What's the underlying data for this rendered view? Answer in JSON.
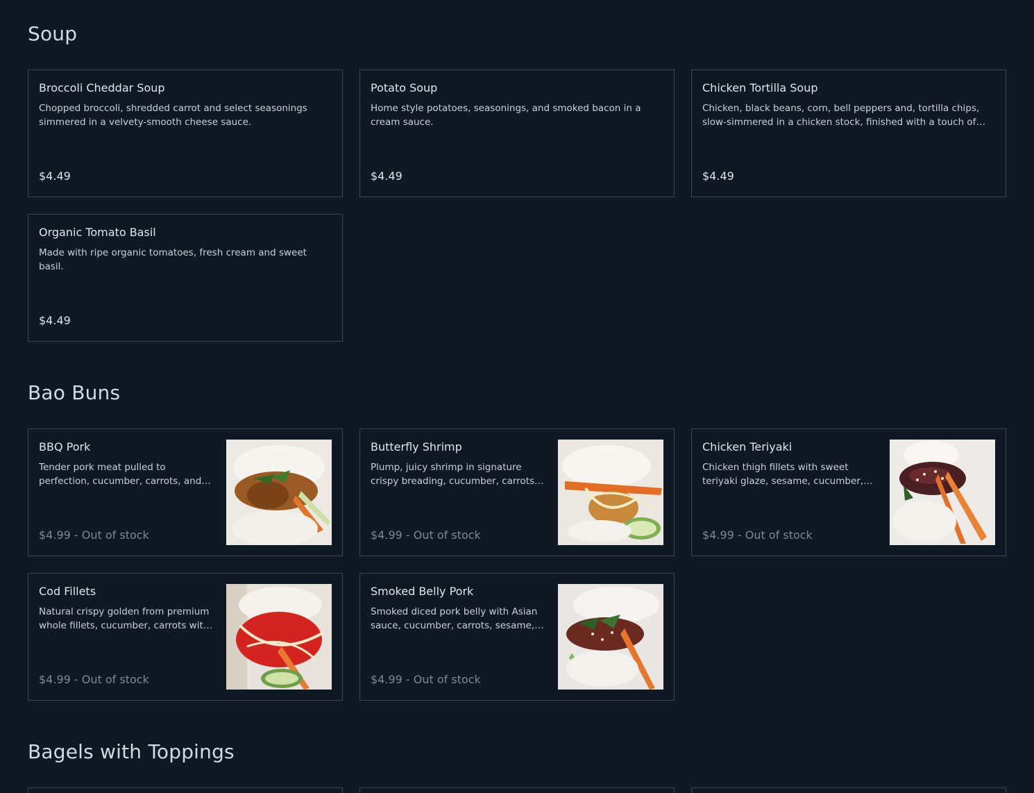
{
  "sections": [
    {
      "title": "Soup",
      "items": [
        {
          "name": "Broccoli Cheddar Soup",
          "description": "Chopped broccoli, shredded carrot and select seasonings simmered in a velvety-smooth cheese sauce.",
          "price": "$4.49"
        },
        {
          "name": "Potato Soup",
          "description": "Home style potatoes, seasonings, and smoked bacon in a cream sauce.",
          "price": "$4.49"
        },
        {
          "name": "Chicken Tortilla Soup",
          "description": "Chicken, black beans, corn, bell peppers and, tortilla chips, slow-simmered in a chicken stock, finished with a touch of lime and ...",
          "price": "$4.49"
        },
        {
          "name": "Organic Tomato Basil",
          "description": "Made with ripe organic tomatoes, fresh cream and sweet basil.",
          "price": "$4.49"
        }
      ]
    },
    {
      "title": "Bao Buns",
      "items": [
        {
          "name": "BBQ Pork",
          "description": "Tender pork meat pulled to perfection, cucumber, carrots, and cilantro.",
          "price": "$4.99 - Out of stock",
          "image": "bao-bun-bbq-pork-photo"
        },
        {
          "name": "Butterfly Shrimp",
          "description": "Plump, juicy shrimp in signature crispy breading, cucumber, carrots with Asia...",
          "price": "$4.99 - Out of stock",
          "image": "bao-bun-butterfly-shrimp-photo"
        },
        {
          "name": "Chicken Teriyaki",
          "description": "Chicken thigh fillets with sweet teriyaki glaze, sesame, cucumber, carrots, ...",
          "price": "$4.99 - Out of stock",
          "image": "bao-bun-chicken-teriyaki-photo"
        },
        {
          "name": "Cod Fillets",
          "description": "Natural crispy golden from premium whole fillets, cucumber, carrots with ...",
          "price": "$4.99 - Out of stock",
          "image": "bao-bun-cod-fillets-photo"
        },
        {
          "name": "Smoked Belly Pork",
          "description": "Smoked diced pork belly with Asian sauce, cucumber, carrots, sesame, an...",
          "price": "$4.99 - Out of stock",
          "image": "bao-bun-smoked-belly-pork-photo"
        }
      ]
    },
    {
      "title": "Bagels with Toppings",
      "items": []
    }
  ],
  "colors": {
    "background": "#0f1923",
    "card_border": "#3b4550",
    "text": "#e1e7ec",
    "muted_price": "#7d8893"
  }
}
